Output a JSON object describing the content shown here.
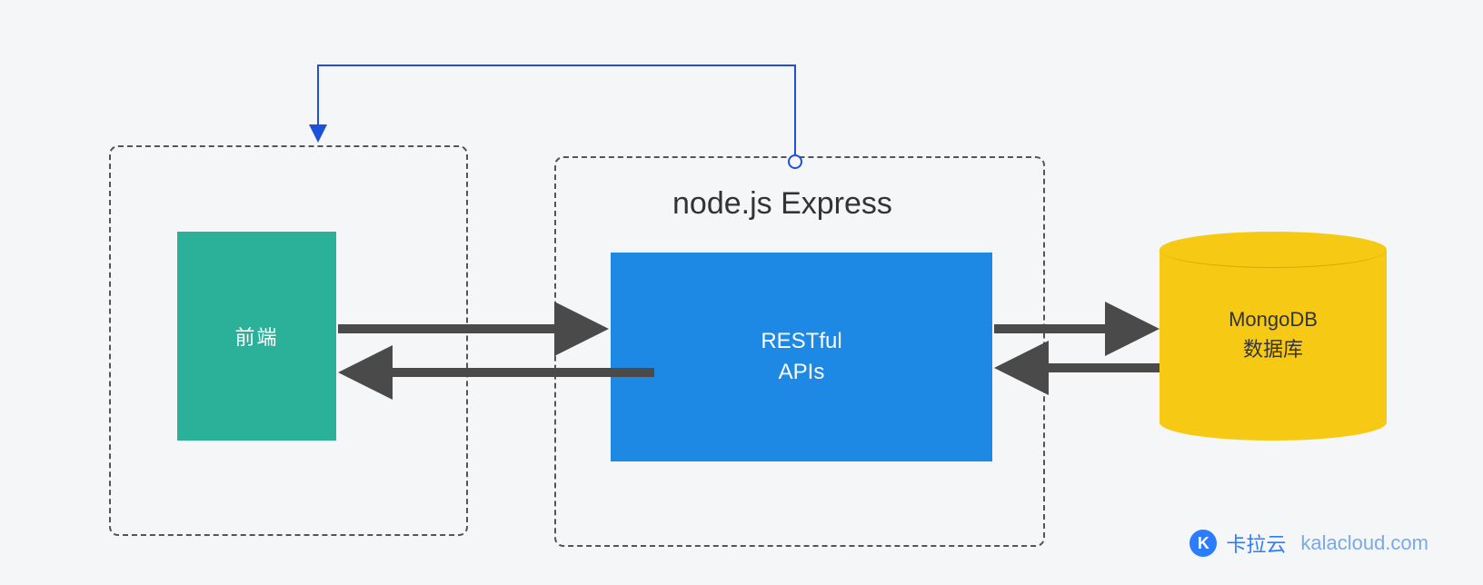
{
  "frontend": {
    "label": "前端"
  },
  "backend": {
    "title": "node.js Express",
    "api_label_line1": "RESTful",
    "api_label_line2": "APIs"
  },
  "database": {
    "name": "MongoDB",
    "subtitle": "数据库"
  },
  "watermark": {
    "logo_initial": "K",
    "cn": "卡拉云",
    "en": "kalacloud.com"
  },
  "colors": {
    "frontend_block": "#2bb199",
    "api_block": "#1e88e5",
    "database": "#f6c914",
    "arrow": "#4a4a4a",
    "thin_arrow": "#1e50d8",
    "brand": "#2b7cff"
  }
}
